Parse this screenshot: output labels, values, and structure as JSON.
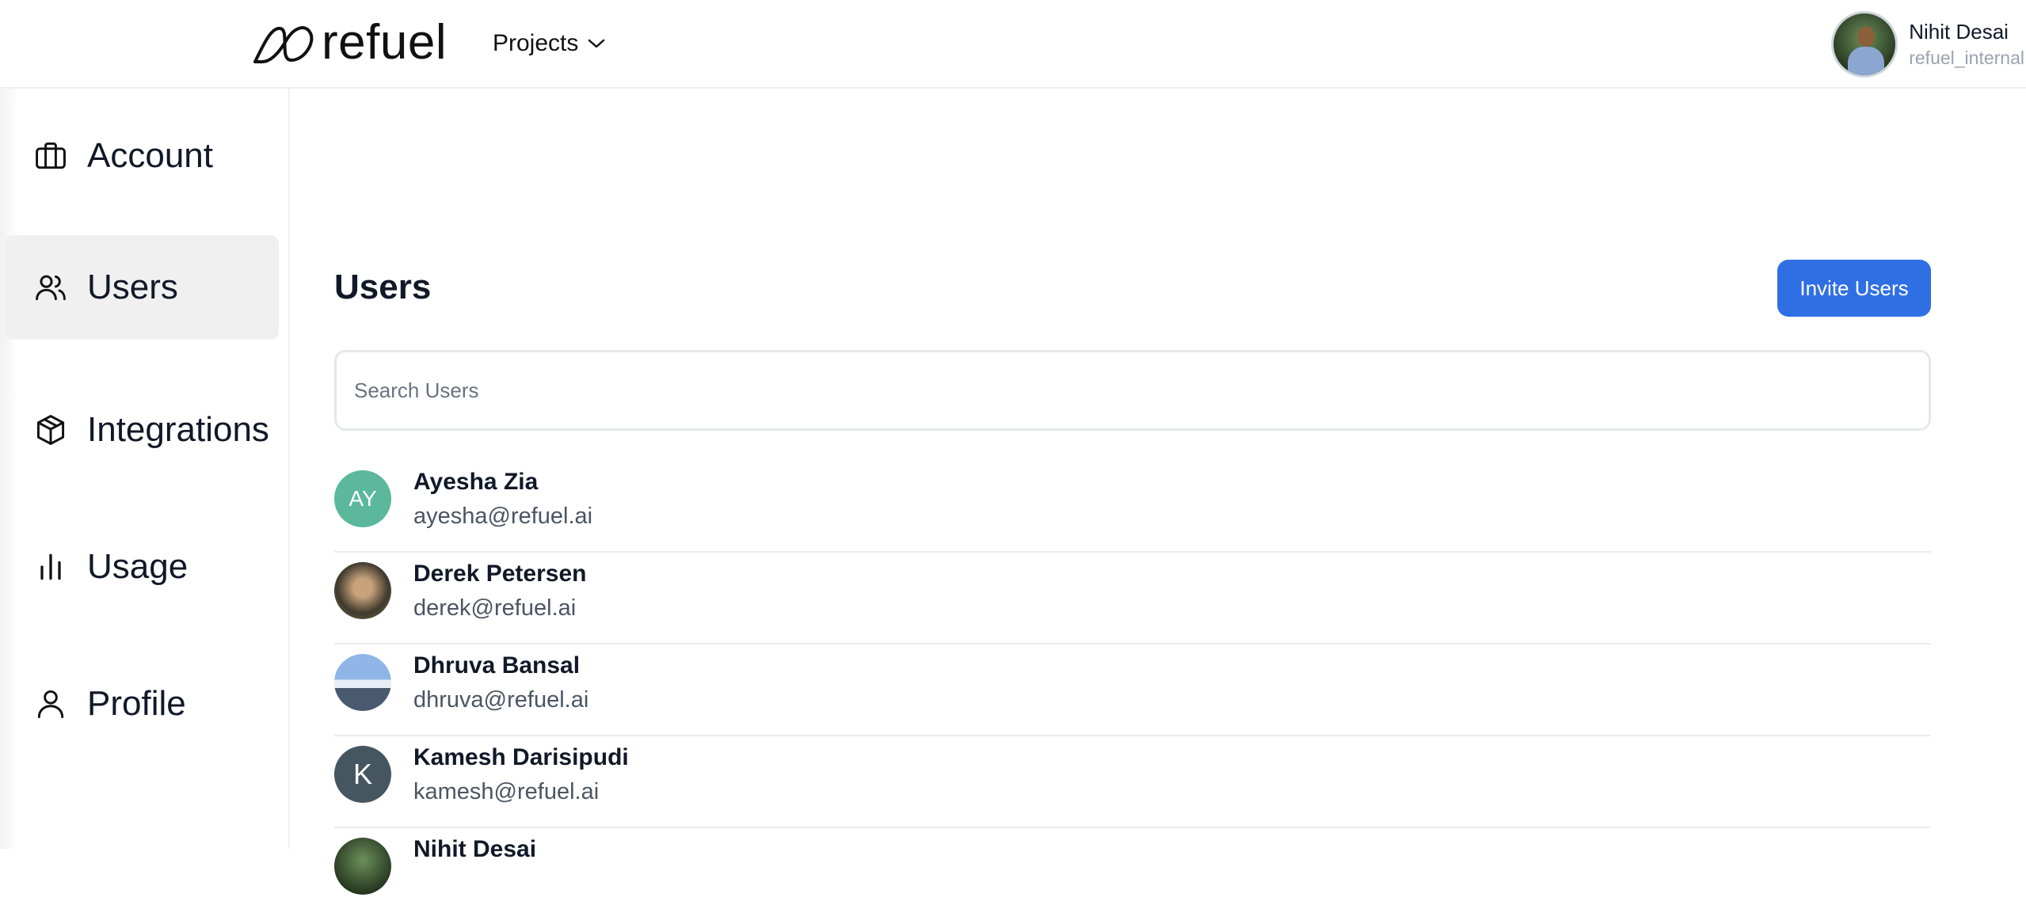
{
  "header": {
    "brand": "refuel",
    "projects_label": "Projects",
    "user_name": "Nihit Desai",
    "user_org": "refuel_internal"
  },
  "sidebar": {
    "items": [
      {
        "label": "Account",
        "icon": "briefcase-icon",
        "active": false
      },
      {
        "label": "Users",
        "icon": "users-icon",
        "active": true
      },
      {
        "label": "Integrations",
        "icon": "cube-icon",
        "active": false
      },
      {
        "label": "Usage",
        "icon": "bar-chart-icon",
        "active": false
      },
      {
        "label": "Profile",
        "icon": "user-icon",
        "active": false
      }
    ]
  },
  "main": {
    "title": "Users",
    "invite_button": "Invite Users",
    "search_placeholder": "Search Users",
    "users": [
      {
        "name": "Ayesha Zia",
        "email": "ayesha@refuel.ai",
        "avatar": "AY",
        "avatar_color": "#5bb89b"
      },
      {
        "name": "Derek Petersen",
        "email": "derek@refuel.ai",
        "avatar": "photo",
        "avatar_color": "#3f3a2e"
      },
      {
        "name": "Dhruva Bansal",
        "email": "dhruva@refuel.ai",
        "avatar": "photo",
        "avatar_color": "#8fb6e6"
      },
      {
        "name": "Kamesh Darisipudi",
        "email": "kamesh@refuel.ai",
        "avatar": "K",
        "avatar_color": "#465660"
      },
      {
        "name": "Nihit Desai",
        "email": "",
        "avatar": "photo",
        "avatar_color": "#24341f"
      }
    ]
  },
  "colors": {
    "accent": "#2f6fe4",
    "active_nav_bg": "#f0f0f0",
    "border": "#e5e7eb"
  }
}
